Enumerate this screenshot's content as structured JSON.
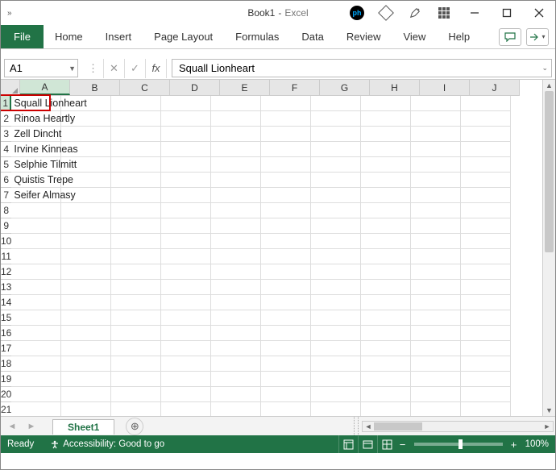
{
  "titlebar": {
    "book": "Book1",
    "sep": " - ",
    "app": "Excel"
  },
  "ribbon": {
    "file": "File",
    "tabs": [
      "Home",
      "Insert",
      "Page Layout",
      "Formulas",
      "Data",
      "Review",
      "View",
      "Help"
    ]
  },
  "namebox": "A1",
  "formula": "Squall Lionheart",
  "columns": [
    "A",
    "B",
    "C",
    "D",
    "E",
    "F",
    "G",
    "H",
    "I",
    "J"
  ],
  "rows_visible": 21,
  "cell_data": {
    "A1": "Squall Lionheart",
    "A2": "Rinoa Heartly",
    "A3": "Zell Dincht",
    "A4": "Irvine Kinneas",
    "A5": "Selphie Tilmitt",
    "A6": "Quistis Trepe",
    "A7": "Seifer Almasy"
  },
  "active_cell": "A1",
  "sheet": {
    "name": "Sheet1"
  },
  "status": {
    "ready": "Ready",
    "accessibility": "Accessibility: Good to go",
    "zoom": "100%"
  }
}
